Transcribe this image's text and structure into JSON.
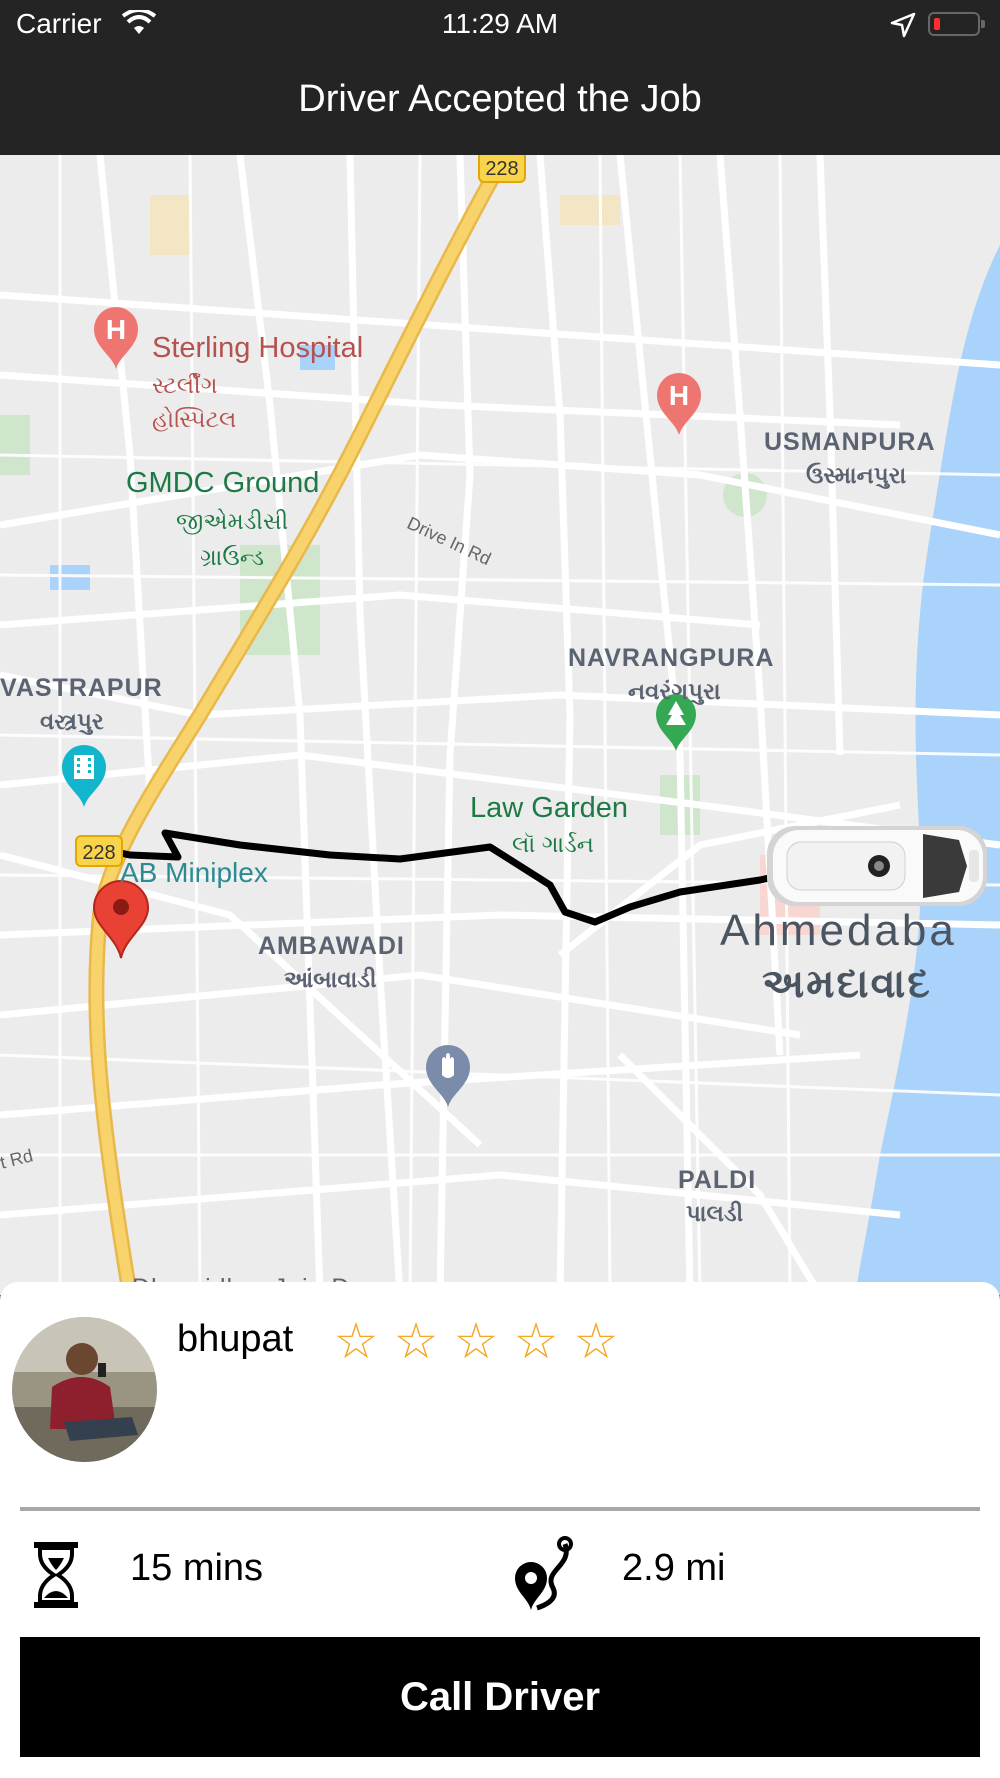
{
  "status": {
    "carrier": "Carrier",
    "time": "11:29 AM"
  },
  "nav": {
    "title": "Driver Accepted the Job"
  },
  "map": {
    "labels": {
      "sterling": "Sterling Hospital",
      "sterling_gu1": "સ્ટર્લીંગ",
      "sterling_gu2": "હોસ્પિટલ",
      "gmdc": "GMDC Ground",
      "gmdc_gu1": "જીએમડીસી",
      "gmdc_gu2": "ગ્રાઉન્ડ",
      "usmanpura": "USMANPURA",
      "usmanpura_gu": "ઉસ્માનપુરા",
      "navrangpura": "NAVRANGPURA",
      "navrangpura_gu": "નવરંગપુરા",
      "vastrapur": "VASTRAPUR",
      "vastrapur_gu": "વસ્ત્રપુર",
      "law_garden": "Law Garden",
      "law_garden_gu": "લૉ ગાર્ડન",
      "ab_miniplex": "AB Miniplex",
      "ambawadi": "AMBAWADI",
      "ambawadi_gu": "આંબાવાડી",
      "ahmedabad": "Ahmedaba",
      "ahmedabad_gu": "અમદાવાદ",
      "paldi": "PALDI",
      "paldi_gu": "પાલડી",
      "drive_in_rd": "Drive In Rd",
      "rd": "t Rd",
      "dharnidhar": "Dharnidhar Jain Derasar"
    },
    "highway_shields": [
      "228",
      "228"
    ]
  },
  "driver": {
    "name": "bhupat",
    "rating": 0,
    "rating_max": 5,
    "stars": [
      "☆",
      "☆",
      "☆",
      "☆",
      "☆"
    ]
  },
  "trip": {
    "eta": "15 mins",
    "distance": "2.9 mi"
  },
  "actions": {
    "call_label": "Call Driver"
  },
  "colors": {
    "nav_bg": "#242424",
    "map_bg": "#ececec",
    "water": "#a9d3fa",
    "highway": "#f8d36b",
    "route": "#000000",
    "star": "#f5a623",
    "button_bg": "#000000",
    "pin": "#e94235"
  },
  "icons": {
    "eta": "hourglass-icon",
    "distance": "route-pin-icon",
    "pickup": "map-pin-icon",
    "vehicle": "car-icon"
  }
}
